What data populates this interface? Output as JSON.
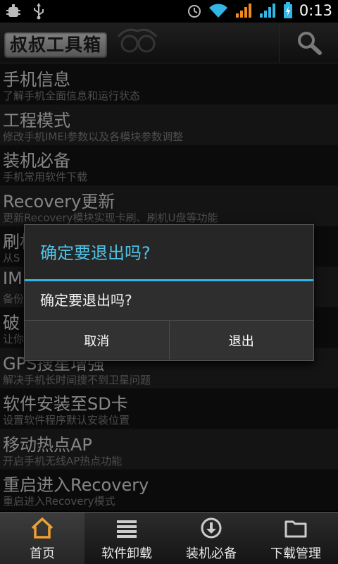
{
  "status_bar": {
    "time": "0:13",
    "left_icons": [
      "debug-icon",
      "usb-icon"
    ],
    "right_icons": [
      "alarm-icon",
      "wifi-icon",
      "signal-orange-icon",
      "signal-blue-icon",
      "battery-charging-icon"
    ]
  },
  "header": {
    "app_title": "叔叔工具箱",
    "search_icon": "search-icon"
  },
  "list": [
    {
      "title": "手机信息",
      "subtitle": "了解手机全面信息和运行状态"
    },
    {
      "title": "工程模式",
      "subtitle": "修改手机IMEI参数以及各模块参数调整"
    },
    {
      "title": "装机必备",
      "subtitle": "手机常用软件下载"
    },
    {
      "title": "Recovery更新",
      "subtitle": "更新Recovery模块实现卡刷、刷机U盘等功能"
    },
    {
      "title": "刷机",
      "subtitle": "从S"
    },
    {
      "title": "IM",
      "subtitle": "备份"
    },
    {
      "title": "破",
      "subtitle": "让你"
    },
    {
      "title": "GPS搜星增强",
      "subtitle": "解决手机长时间搜不到卫星问题"
    },
    {
      "title": "软件安装至SD卡",
      "subtitle": "设置软件程序默认安装位置"
    },
    {
      "title": "移动热点AP",
      "subtitle": "开启手机无线AP热点功能"
    },
    {
      "title": "重启进入Recovery",
      "subtitle": "重启进入Recovery模式"
    }
  ],
  "dialog": {
    "title": "确定要退出吗?",
    "message": "确定要退出吗?",
    "cancel_label": "取消",
    "exit_label": "退出"
  },
  "tabs": [
    {
      "label": "首页",
      "icon": "home-icon",
      "active": true
    },
    {
      "label": "软件卸载",
      "icon": "list-icon",
      "active": false
    },
    {
      "label": "装机必备",
      "icon": "download-circle-icon",
      "active": false
    },
    {
      "label": "下载管理",
      "icon": "folder-icon",
      "active": false
    }
  ],
  "colors": {
    "accent": "#33b5e5",
    "home_icon": "#f0a030",
    "signal_orange": "#f08a1c",
    "signal_blue": "#33b5e5"
  }
}
